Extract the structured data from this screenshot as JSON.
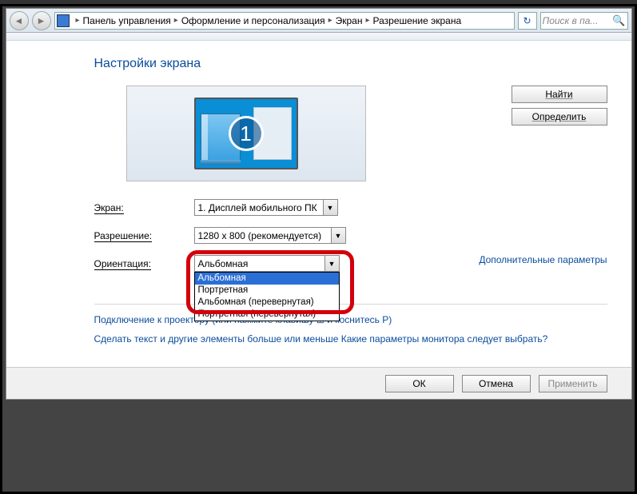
{
  "nav": {
    "crumbs": [
      "Панель управления",
      "Оформление и персонализация",
      "Экран",
      "Разрешение экрана"
    ],
    "search_placeholder": "Поиск в па..."
  },
  "page": {
    "title": "Настройки экрана",
    "monitor_number": "1",
    "buttons": {
      "detect": "Найти",
      "identify": "Определить"
    },
    "labels": {
      "display": "Экран:",
      "resolution": "Разрешение:",
      "orientation": "Ориентация:"
    },
    "display_value": "1. Дисплей мобильного ПК",
    "resolution_value": "1280 x 800 (рекомендуется)",
    "orientation_value": "Альбомная",
    "orientation_options": [
      "Альбомная",
      "Портретная",
      "Альбомная (перевернутая)",
      "Портретная (перевернутая)"
    ],
    "adv_link": "Дополнительные параметры",
    "link_projector": "Подключение к проектору (или нажмите клавишу ⊞ и коснитесь P)",
    "link_textsize": "Сделать текст и другие элементы больше или меньше",
    "link_whichmon": "Какие параметры монитора следует выбрать?"
  },
  "footer": {
    "ok": "ОК",
    "cancel": "Отмена",
    "apply": "Применить"
  }
}
